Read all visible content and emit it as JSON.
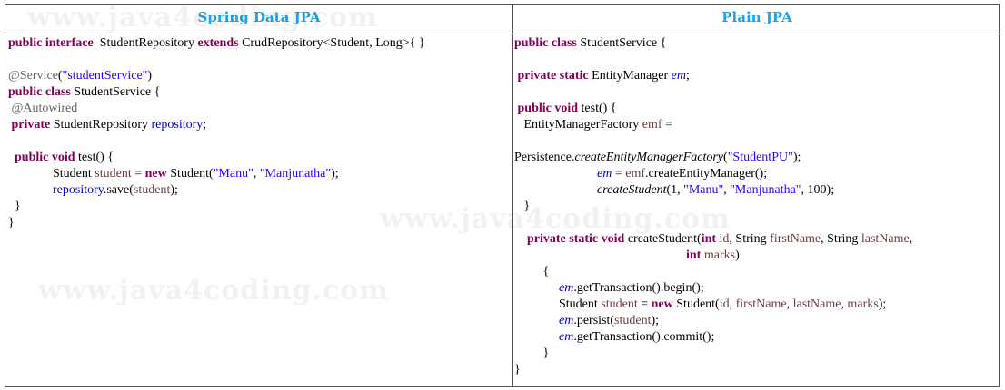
{
  "headers": {
    "left": "Spring Data JPA",
    "right": "Plain JPA"
  },
  "watermark": "www.java4coding.com",
  "colors": {
    "header": "#1fa3e6",
    "keyword": "#7f0055",
    "field": "#0000c0",
    "string": "#2a00ff",
    "variable": "#6a3e3e",
    "annotation": "#646464"
  },
  "spring_code": [
    [
      [
        "kw",
        "public interface"
      ],
      [
        "t",
        "  StudentRepository "
      ],
      [
        "kw",
        "extends"
      ],
      [
        "t",
        " CrudRepository<Student, Long>{ }"
      ]
    ],
    [],
    [
      [
        "ann",
        "@Service"
      ],
      [
        "t",
        "("
      ],
      [
        "str",
        "\"studentService\""
      ],
      [
        "t",
        ")"
      ]
    ],
    [
      [
        "kw",
        "public class"
      ],
      [
        "t",
        " StudentService {"
      ]
    ],
    [
      [
        "ann",
        " @Autowired"
      ]
    ],
    [
      [
        "t",
        " "
      ],
      [
        "kw",
        "private"
      ],
      [
        "t",
        " StudentRepository "
      ],
      [
        "fld",
        "repository"
      ],
      [
        "t",
        ";"
      ]
    ],
    [],
    [
      [
        "t",
        "  "
      ],
      [
        "kw",
        "public void"
      ],
      [
        "t",
        " test() {"
      ]
    ],
    [
      [
        "t",
        "              Student "
      ],
      [
        "var",
        "student"
      ],
      [
        "t",
        " = "
      ],
      [
        "kw",
        "new"
      ],
      [
        "t",
        " Student("
      ],
      [
        "str",
        "\"Manu\""
      ],
      [
        "t",
        ", "
      ],
      [
        "str",
        "\"Manjunatha\""
      ],
      [
        "t",
        ");"
      ]
    ],
    [
      [
        "t",
        "              "
      ],
      [
        "fld",
        "repository"
      ],
      [
        "t",
        ".save("
      ],
      [
        "var",
        "student"
      ],
      [
        "t",
        ");"
      ]
    ],
    [
      [
        "t",
        "  }"
      ]
    ],
    [
      [
        "t",
        "}"
      ]
    ]
  ],
  "plain_code": [
    [
      [
        "kw",
        "public class"
      ],
      [
        "t",
        " StudentService {"
      ]
    ],
    [],
    [
      [
        "t",
        " "
      ],
      [
        "kw",
        "private static"
      ],
      [
        "t",
        " EntityManager "
      ],
      [
        "fldi",
        "em"
      ],
      [
        "t",
        ";"
      ]
    ],
    [],
    [
      [
        "t",
        " "
      ],
      [
        "kw",
        "public void"
      ],
      [
        "t",
        " test() {"
      ]
    ],
    [
      [
        "t",
        "   EntityManagerFactory "
      ],
      [
        "var",
        "emf"
      ],
      [
        "t",
        " ="
      ]
    ],
    [],
    [
      [
        "t",
        "Persistence."
      ],
      [
        "it",
        "createEntityManagerFactory"
      ],
      [
        "t",
        "("
      ],
      [
        "str",
        "\"StudentPU\""
      ],
      [
        "t",
        ");"
      ]
    ],
    [
      [
        "t",
        "                          "
      ],
      [
        "fldi",
        "em"
      ],
      [
        "t",
        " = "
      ],
      [
        "var",
        "emf"
      ],
      [
        "t",
        ".createEntityManager();"
      ]
    ],
    [
      [
        "t",
        "                          "
      ],
      [
        "it",
        "createStudent"
      ],
      [
        "t",
        "(1, "
      ],
      [
        "str",
        "\"Manu\""
      ],
      [
        "t",
        ", "
      ],
      [
        "str",
        "\"Manjunatha\""
      ],
      [
        "t",
        ", 100);"
      ]
    ],
    [
      [
        "t",
        "   }"
      ]
    ],
    [],
    [
      [
        "t",
        "    "
      ],
      [
        "kw",
        "private static void"
      ],
      [
        "t",
        " createStudent("
      ],
      [
        "kw",
        "int"
      ],
      [
        "t",
        " "
      ],
      [
        "var",
        "id"
      ],
      [
        "t",
        ", String "
      ],
      [
        "var",
        "firstName"
      ],
      [
        "t",
        ", String "
      ],
      [
        "var",
        "lastName"
      ],
      [
        "t",
        ","
      ]
    ],
    [
      [
        "t",
        "                                                      "
      ],
      [
        "kw",
        "int"
      ],
      [
        "t",
        " "
      ],
      [
        "var",
        "marks"
      ],
      [
        "t",
        ")"
      ]
    ],
    [
      [
        "t",
        "         {"
      ]
    ],
    [
      [
        "t",
        "              "
      ],
      [
        "fldi",
        "em"
      ],
      [
        "t",
        ".getTransaction().begin();"
      ]
    ],
    [
      [
        "t",
        "              Student "
      ],
      [
        "var",
        "student"
      ],
      [
        "t",
        " = "
      ],
      [
        "kw",
        "new"
      ],
      [
        "t",
        " Student("
      ],
      [
        "var",
        "id"
      ],
      [
        "t",
        ", "
      ],
      [
        "var",
        "firstName"
      ],
      [
        "t",
        ", "
      ],
      [
        "var",
        "lastName"
      ],
      [
        "t",
        ", "
      ],
      [
        "var",
        "marks"
      ],
      [
        "t",
        ");"
      ]
    ],
    [
      [
        "t",
        "              "
      ],
      [
        "fldi",
        "em"
      ],
      [
        "t",
        ".persist("
      ],
      [
        "var",
        "student"
      ],
      [
        "t",
        ");"
      ]
    ],
    [
      [
        "t",
        "              "
      ],
      [
        "fldi",
        "em"
      ],
      [
        "t",
        ".getTransaction().commit();"
      ]
    ],
    [
      [
        "t",
        "         }"
      ]
    ],
    [
      [
        "t",
        "}"
      ]
    ]
  ]
}
